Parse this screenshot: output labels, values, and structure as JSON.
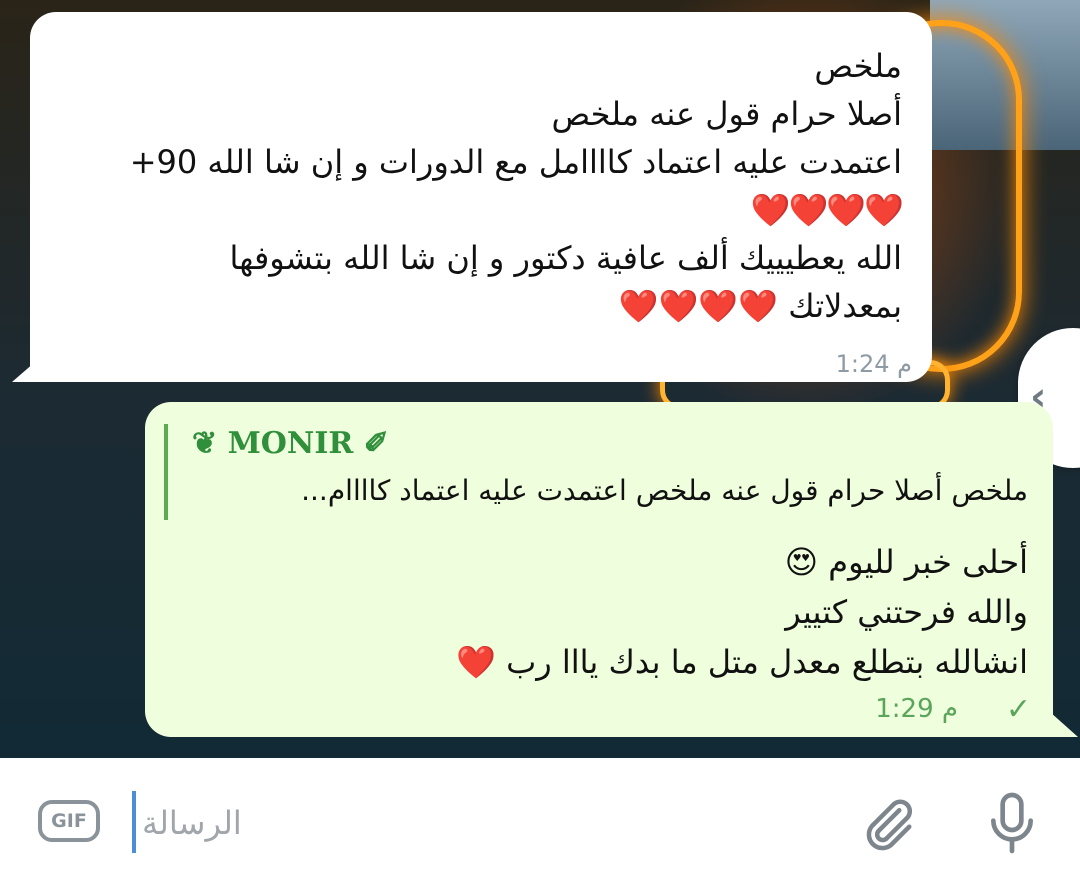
{
  "chat": {
    "incoming": {
      "lines": [
        "ملخص",
        "أصلا حرام قول عنه ملخص",
        "اعتمدت عليه اعتماد كاااامل مع الدورات و إن شا الله 90+",
        "❤️❤️❤️❤️",
        "الله يعطيييك ألف عافية دكتور و إن شا الله بتشوفها",
        "بمعدلاتك ❤️❤️❤️❤️"
      ],
      "time": "1:24 م"
    },
    "outgoing": {
      "reply_name": "❦ MONIR ✐",
      "reply_text": "ملخص أصلا حرام قول عنه ملخص اعتمدت عليه اعتماد كاااام...",
      "lines": [
        "أحلى خبر لليوم 😍",
        "والله فرحتني كتيير",
        "انشالله بتطلع معدل متل ما بدك يااا رب ❤️"
      ],
      "time": "1:29 م",
      "status_icon": "single-check-icon"
    }
  },
  "input_bar": {
    "gif_label": "GIF",
    "placeholder": "الرسالة",
    "attach_icon": "paperclip-icon",
    "mic_icon": "microphone-icon"
  },
  "collapse_button": {
    "icon": "chevron-left-icon"
  },
  "colors": {
    "incoming_bubble": "#ffffff",
    "outgoing_bubble": "#effedd",
    "accent_green": "#5aa55a",
    "reply_name": "#2f8f3a"
  }
}
